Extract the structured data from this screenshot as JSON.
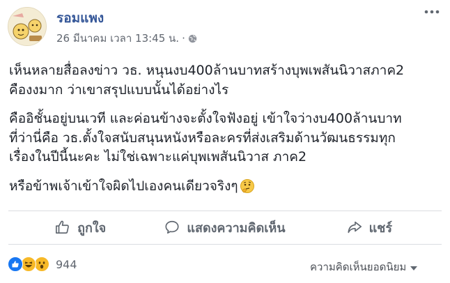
{
  "post": {
    "author": "รอมแพง",
    "timestamp": "26 มีนาคม เวลา 13:45 น.",
    "separator": "·",
    "privacy_icon": "globe-icon",
    "paragraphs": [
      [
        "เห็นหลายสื่อลงข่าว วธ. หนุนงบ400ล้านบาทสร้างบุพเพสันนิวาสภาค2",
        "คืองงมาก ว่าเขาสรุปแบบนั้นได้อย่างไร"
      ],
      [
        "คืออิชั้นอยู่บนเวที และค่อนข้างจะตั้งใจฟังอยู่ เข้าใจว่างบ400ล้านบาท",
        "ที่ว่านี่คือ วธ.ตั้งใจสนับสนุนหนังหรือละครที่ส่งเสริมด้านวัฒนธรรมทุก",
        "เรื่องในปีนี้นะคะ ไม่ใช่เฉพาะแค่บุพเพสันนิวาส ภาค2"
      ],
      [
        "หรือข้าพเจ้าเข้าใจผิดไปเองคนเดียวจริงๆ"
      ]
    ],
    "trailing_emoji_icon": "thinking-face-icon"
  },
  "actions": {
    "like_label": "ถูกใจ",
    "comment_label": "แสดงความคิดเห็น",
    "share_label": "แชร์"
  },
  "reactions": {
    "icons": [
      "like-icon",
      "haha-icon",
      "wow-icon"
    ],
    "count": "944",
    "sort_label": "ความคิดเห็นยอดนิยม"
  },
  "colors": {
    "author": "#365899",
    "text": "#1d2129",
    "muted": "#616770",
    "divider": "#dadde1",
    "like_blue": "#1877f2",
    "emoji_yellow": "#f7b928"
  }
}
